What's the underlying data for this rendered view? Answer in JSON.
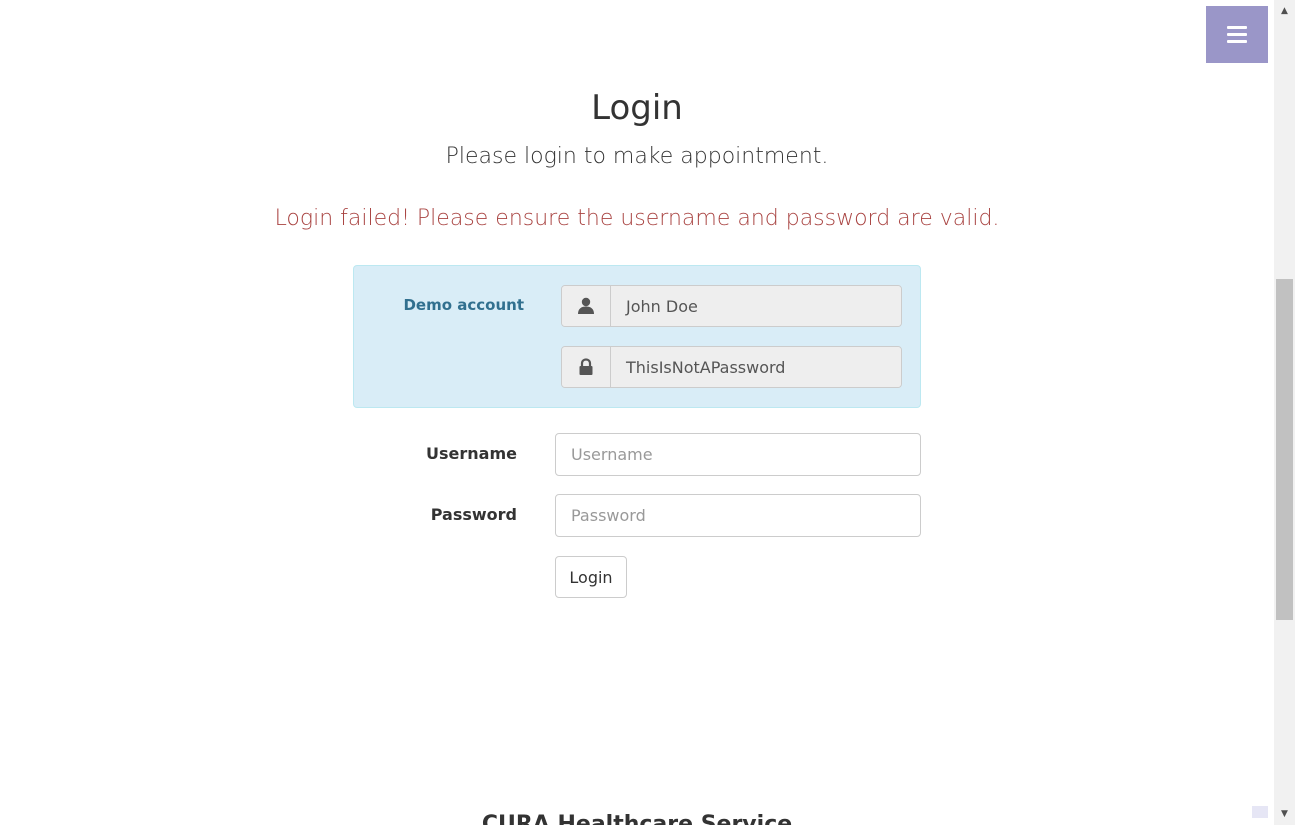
{
  "menu": {
    "icon": "hamburger-icon"
  },
  "page": {
    "title": "Login",
    "subtitle": "Please login to make appointment.",
    "error": "Login failed! Please ensure the username and password are valid."
  },
  "demo": {
    "label": "Demo account",
    "username": "John Doe",
    "password": "ThisIsNotAPassword",
    "user_icon": "user-icon",
    "lock_icon": "lock-icon"
  },
  "form": {
    "username_label": "Username",
    "username_placeholder": "Username",
    "password_label": "Password",
    "password_placeholder": "Password",
    "login_label": "Login"
  },
  "footer": {
    "title": "CURA Healthcare Service"
  },
  "colors": {
    "menu_bg": "#9a96c8",
    "error": "#a94442",
    "demo_bg": "#d9edf7",
    "demo_label": "#31708f"
  }
}
